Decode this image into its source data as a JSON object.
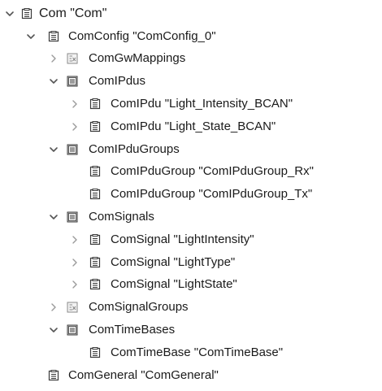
{
  "tree": {
    "com": {
      "label": "Com \"Com\"",
      "icon": "container-icon",
      "state": "expanded"
    },
    "comconfig": {
      "label": "ComConfig \"ComConfig_0\"",
      "icon": "container-icon",
      "state": "expanded"
    },
    "comgwmappings": {
      "label": "ComGwMappings",
      "icon": "empty-list-icon",
      "state": "collapsed"
    },
    "comipdus": {
      "label": "ComIPdus",
      "icon": "list-icon",
      "state": "expanded"
    },
    "ipdu_intensity": {
      "label": "ComIPdu \"Light_Intensity_BCAN\"",
      "icon": "container-icon",
      "state": "collapsed"
    },
    "ipdu_state": {
      "label": "ComIPdu \"Light_State_BCAN\"",
      "icon": "container-icon",
      "state": "collapsed"
    },
    "comipdugroups": {
      "label": "ComIPduGroups",
      "icon": "list-icon",
      "state": "expanded"
    },
    "group_rx": {
      "label": "ComIPduGroup \"ComIPduGroup_Rx\"",
      "icon": "container-icon",
      "state": "leaf"
    },
    "group_tx": {
      "label": "ComIPduGroup \"ComIPduGroup_Tx\"",
      "icon": "container-icon",
      "state": "leaf"
    },
    "comsignals": {
      "label": "ComSignals",
      "icon": "list-icon",
      "state": "expanded"
    },
    "sig_intensity": {
      "label": "ComSignal \"LightIntensity\"",
      "icon": "container-icon",
      "state": "collapsed"
    },
    "sig_type": {
      "label": "ComSignal \"LightType\"",
      "icon": "container-icon",
      "state": "collapsed"
    },
    "sig_state": {
      "label": "ComSignal \"LightState\"",
      "icon": "container-icon",
      "state": "collapsed"
    },
    "comsignalgroups": {
      "label": "ComSignalGroups",
      "icon": "empty-list-icon",
      "state": "collapsed"
    },
    "comtimebases": {
      "label": "ComTimeBases",
      "icon": "list-icon",
      "state": "expanded"
    },
    "timebase": {
      "label": "ComTimeBase \"ComTimeBase\"",
      "icon": "container-icon",
      "state": "leaf"
    },
    "comgeneral": {
      "label": "ComGeneral \"ComGeneral\"",
      "icon": "container-icon",
      "state": "leaf"
    }
  },
  "colors": {
    "text": "#1a1a1a",
    "twisty": "#555555",
    "icon_stroke": "#3a3a3a",
    "list_icon_fill": "#d9d9d9",
    "empty_icon_mark": "#888888"
  }
}
